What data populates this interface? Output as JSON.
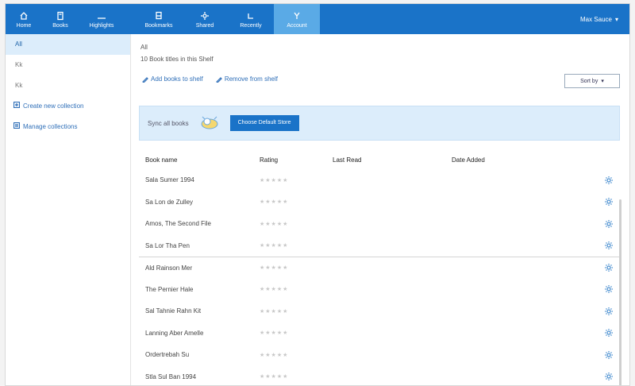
{
  "nav": {
    "items": [
      {
        "label": "Home",
        "icon": "home-icon"
      },
      {
        "label": "Books",
        "icon": "book-icon"
      },
      {
        "label": "Highlights",
        "icon": "highlight-icon"
      },
      {
        "label": "Bookmarks",
        "icon": "bookmark-icon"
      },
      {
        "label": "Shared",
        "icon": "share-icon"
      },
      {
        "label": "Recently",
        "icon": "clock-icon"
      },
      {
        "label": "Account",
        "icon": "account-icon"
      }
    ],
    "active_index": 6,
    "account_label": "Max Sauce"
  },
  "sidebar": {
    "items": [
      {
        "label": "All"
      },
      {
        "label": "Kk"
      },
      {
        "label": "Kk"
      }
    ],
    "links": [
      {
        "label": "Create new collection"
      },
      {
        "label": "Manage collections"
      }
    ]
  },
  "main": {
    "breadcrumb": "All",
    "path_line": "10 Book titles in this Shelf",
    "actions": [
      {
        "label": "Add books to shelf"
      },
      {
        "label": "Remove from shelf"
      }
    ],
    "sort_label": "Sort by"
  },
  "banner": {
    "text": "Sync all books",
    "button_label": "Choose Default Store"
  },
  "table": {
    "headers": [
      "Book name",
      "Rating",
      "Last Read",
      "Date Added"
    ],
    "rows": [
      {
        "name": "Sala Sumer 1994",
        "rating": "★★★★★"
      },
      {
        "name": "Sa Lon de Zulley",
        "rating": "★★★★★"
      },
      {
        "name": "Amos, The Second File",
        "rating": "★★★★★"
      },
      {
        "name": "Sa Lor Tha Pen",
        "rating": "★★★★★"
      },
      {
        "name": "Ald Rainson Mer",
        "rating": "★★★★★"
      },
      {
        "name": "The Pernier Hale",
        "rating": "★★★★★"
      },
      {
        "name": "Sal Tahnie Rahn Kit",
        "rating": "★★★★★"
      },
      {
        "name": "Lanning Aber Amelle",
        "rating": "★★★★★"
      },
      {
        "name": "Ordertrebah Su",
        "rating": "★★★★★"
      },
      {
        "name": "Stla Sul Ban 1994",
        "rating": "★★★★★"
      }
    ]
  }
}
